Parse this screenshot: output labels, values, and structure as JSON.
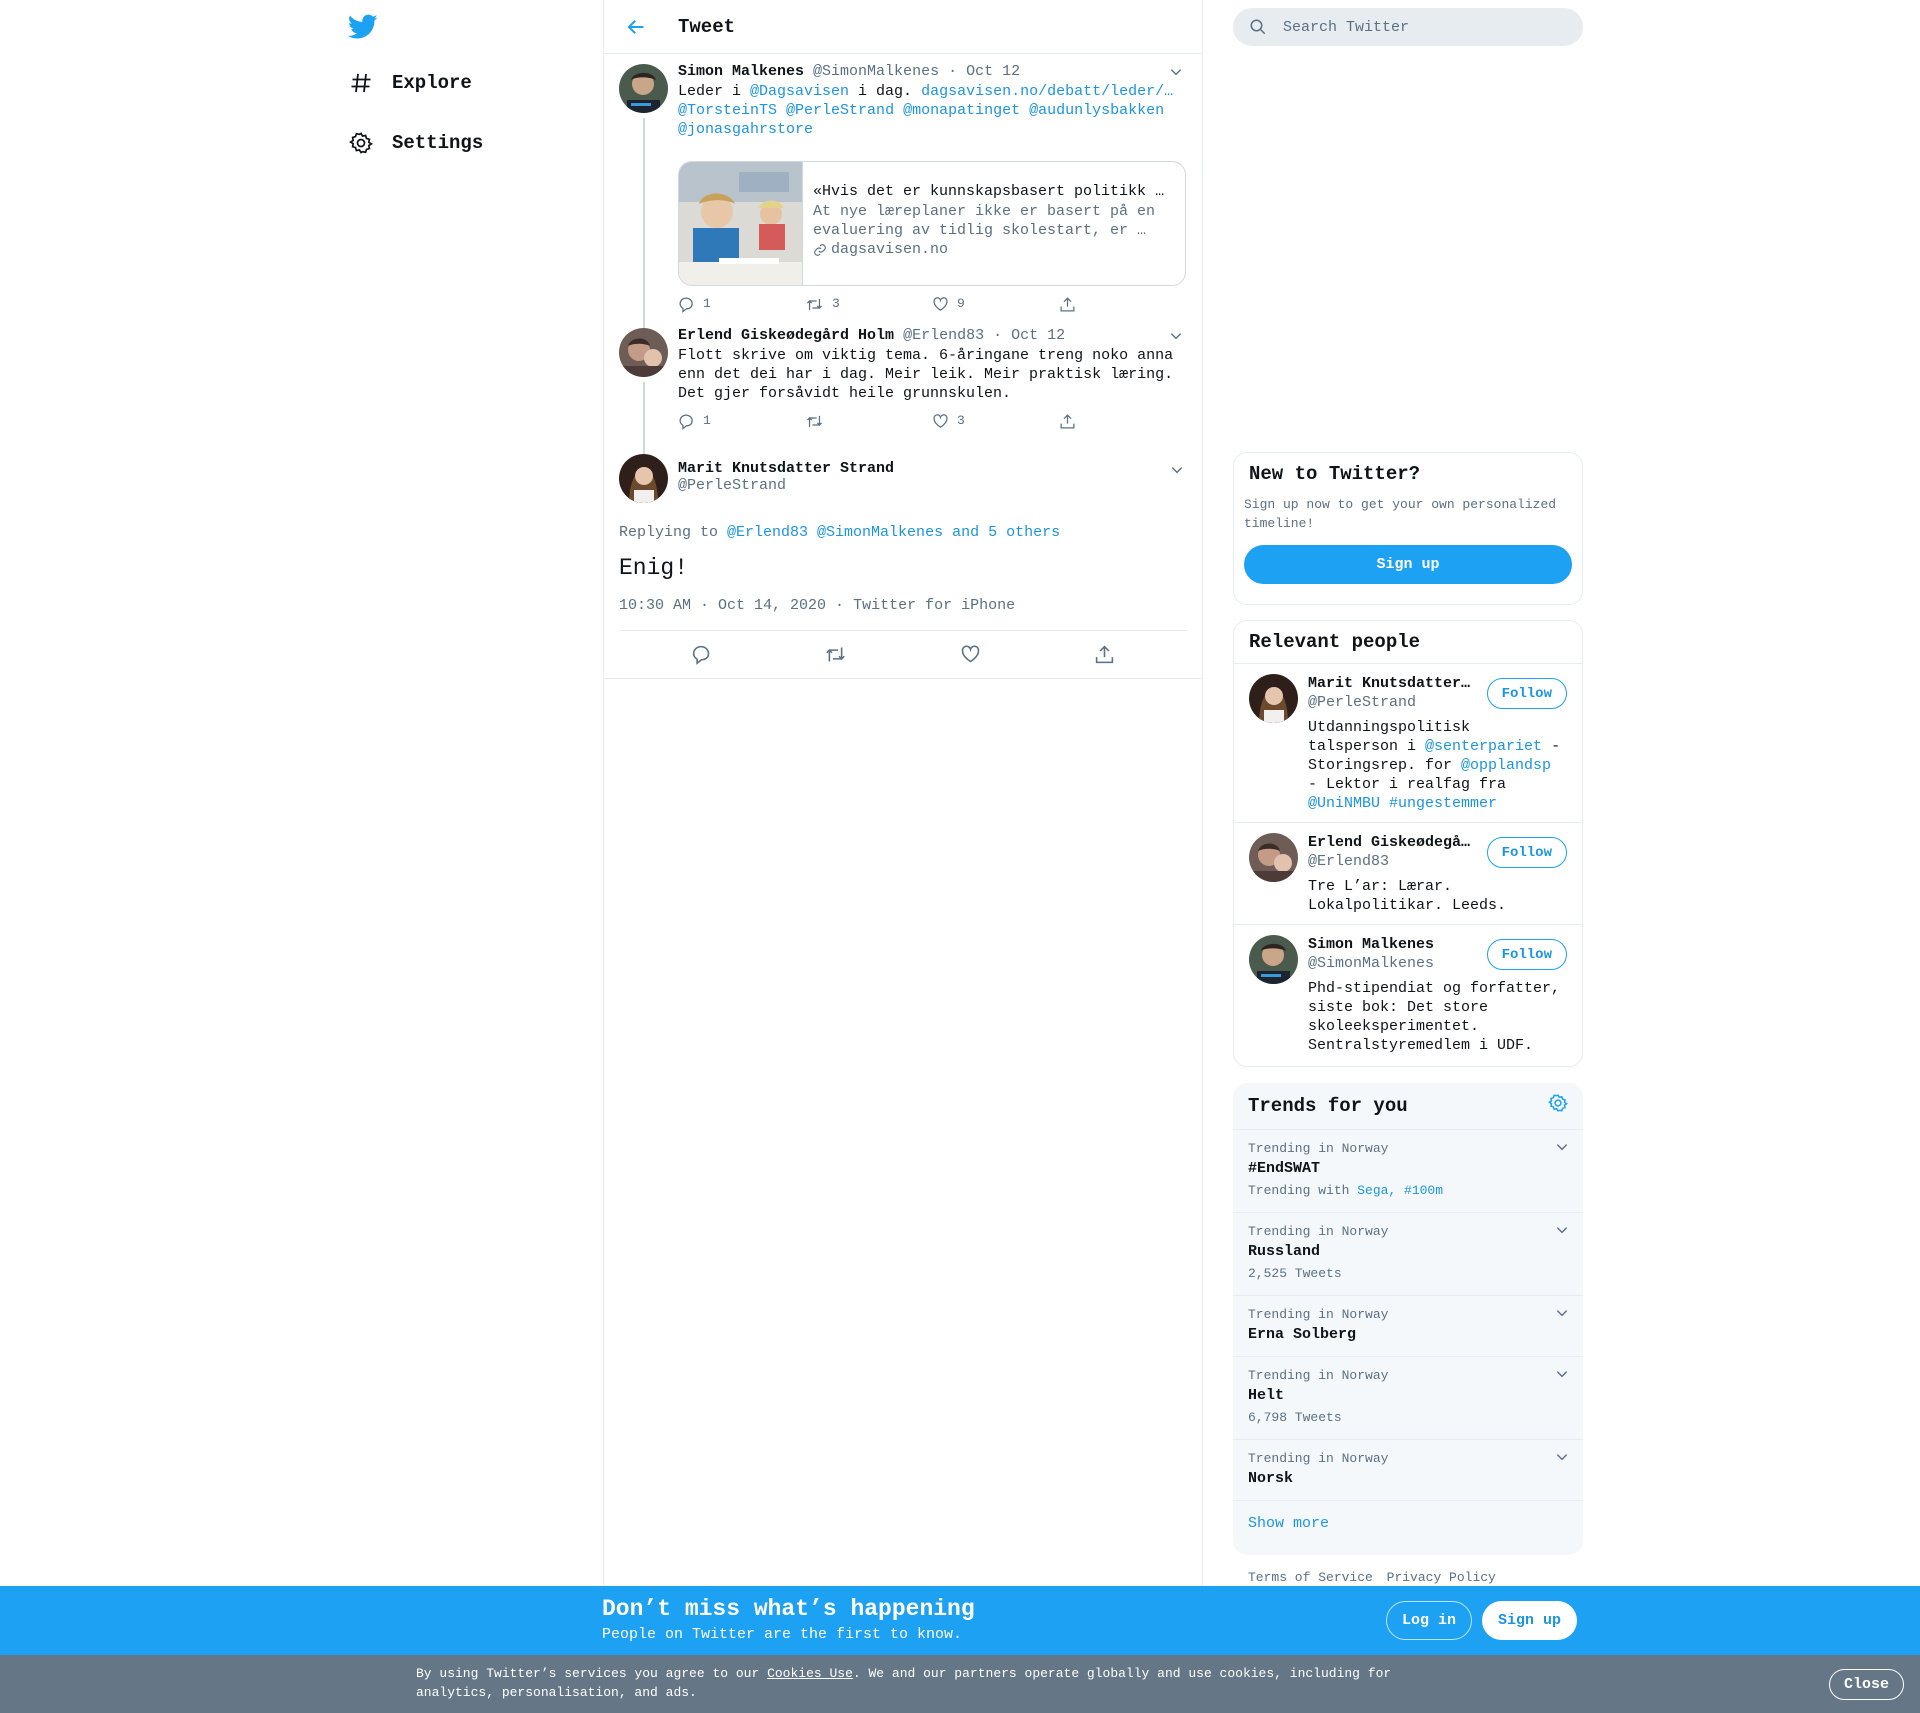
{
  "nav": {
    "logo_icon": "twitter-bird-icon",
    "items": [
      {
        "label": "Explore",
        "icon": "hashtag-icon"
      },
      {
        "label": "Settings",
        "icon": "gear-icon"
      }
    ]
  },
  "header": {
    "title": "Tweet",
    "back_icon": "arrow-left-icon"
  },
  "thread": [
    {
      "name": "Simon Malkenes",
      "handle": "@SimonMalkenes",
      "date": "Oct 12",
      "text_pre": "Leder i ",
      "mention1": "@Dagsavisen",
      "text_mid": " i dag. ",
      "link": "dagsavisen.no/debatt/leder/f…",
      "mentions_line": [
        "@TorsteinTS",
        "@PerleStrand",
        "@monapatinget",
        "@audunlysbakken",
        "@jonasgahrstore"
      ],
      "card": {
        "title": "«Hvis det er kunnskapsbasert politikk H…",
        "desc": "At nye læreplaner ikke er basert på en evaluering av tidlig skolestart, er …",
        "domain": "dagsavisen.no"
      },
      "counts": {
        "reply": "1",
        "retweet": "3",
        "like": "9"
      }
    },
    {
      "name": "Erlend Giskeødegård Holm",
      "handle": "@Erlend83",
      "date": "Oct 12",
      "text": "Flott skrive om viktig tema. 6-åringane treng noko anna enn det dei har i dag. Meir leik. Meir praktisk læring. Det gjer forsåvidt heile grunnskulen.",
      "counts": {
        "reply": "1",
        "retweet": "",
        "like": "3"
      }
    }
  ],
  "main_tweet": {
    "name": "Marit Knutsdatter Strand",
    "handle": "@PerleStrand",
    "replying_prefix": "Replying to ",
    "replying_to": "@Erlend83 @SimonMalkenes and 5 others",
    "text": "Enig!",
    "time": "10:30 AM · Oct 14, 2020",
    "sep": " · ",
    "source": "Twitter for iPhone"
  },
  "search": {
    "placeholder": "Search Twitter"
  },
  "new_to_twitter": {
    "title": "New to Twitter?",
    "text": "Sign up now to get your own personalized timeline!",
    "button": "Sign up"
  },
  "relevant_people": {
    "title": "Relevant people",
    "follow_label": "Follow",
    "people": [
      {
        "name": "Marit Knutsdatter…",
        "handle": "@PerleStrand",
        "bio_parts": [
          "Utdanningspolitisk talsperson i ",
          "@senterpariet",
          " - Storingsrep. for ",
          "@opplandsp",
          " - Lektor i realfag fra ",
          "@UniNMBU",
          " ",
          "#ungestemmer"
        ]
      },
      {
        "name": "Erlend Giskeødegå…",
        "handle": "@Erlend83",
        "bio": "Tre L’ar: Lærar. Lokalpolitikar. Leeds."
      },
      {
        "name": "Simon Malkenes",
        "handle": "@SimonMalkenes",
        "bio": "Phd-stipendiat og forfatter, siste bok: Det store skoleeksperimentet. Sentralstyremedlem i UDF."
      }
    ]
  },
  "trends": {
    "title": "Trends for you",
    "items": [
      {
        "context": "Trending in Norway",
        "name": "#EndSWAT",
        "meta_prefix": "Trending with ",
        "meta_links": "Sega, #100m"
      },
      {
        "context": "Trending in Norway",
        "name": "Russland",
        "meta": "2,525 Tweets"
      },
      {
        "context": "Trending in Norway",
        "name": "Erna Solberg"
      },
      {
        "context": "Trending in Norway",
        "name": "Helt",
        "meta": "6,798 Tweets"
      },
      {
        "context": "Trending in Norway",
        "name": "Norsk"
      }
    ],
    "show_more": "Show more"
  },
  "footer": {
    "terms": "Terms of Service",
    "privacy": "Privacy Policy"
  },
  "promo": {
    "title": "Don’t miss what’s happening",
    "subtitle": "People on Twitter are the first to know.",
    "login": "Log in",
    "signup": "Sign up"
  },
  "cookie": {
    "text_pre": "By using Twitter’s services you agree to our ",
    "link": "Cookies Use",
    "text_post": ". We and our partners operate globally and use cookies, including for analytics, personalisation, and ads.",
    "close": "Close"
  },
  "colors": {
    "accent": "#1da1f2",
    "link": "#1b95e0",
    "muted": "#5b7083",
    "cookie_bar": "#657786"
  }
}
